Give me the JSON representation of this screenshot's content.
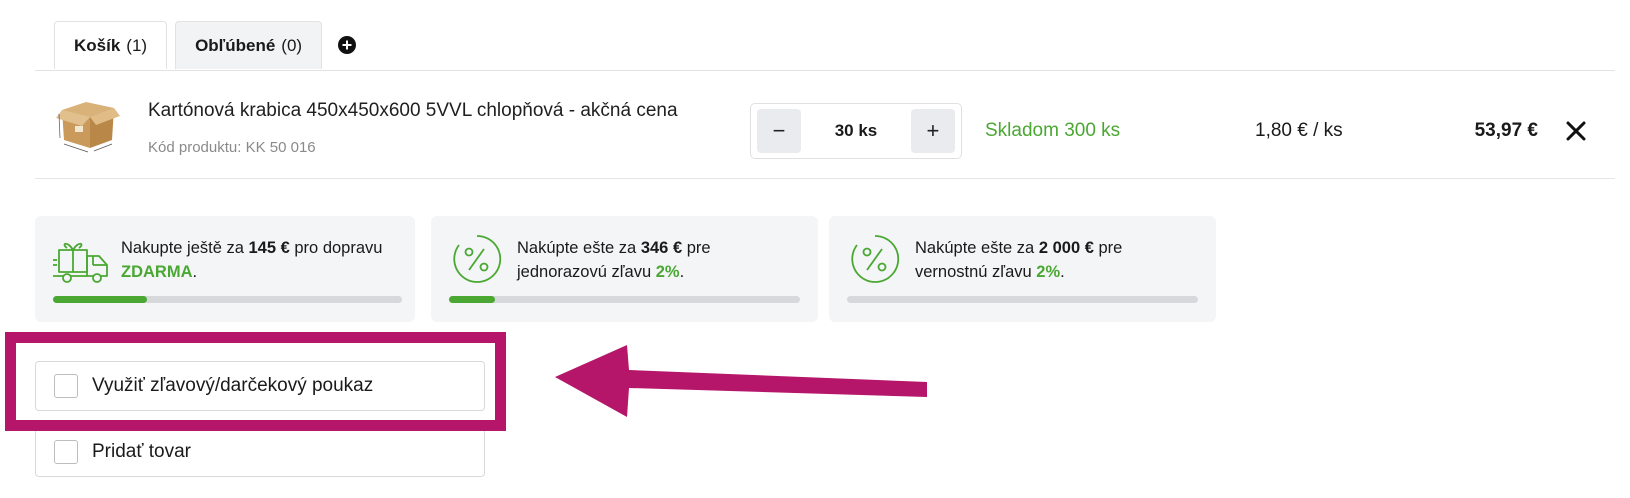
{
  "tabs": [
    {
      "label": "Košík",
      "count": "(1)"
    },
    {
      "label": "Obľúbené",
      "count": "(0)"
    }
  ],
  "icons": {
    "add_tab": "plus-circle-icon",
    "remove": "close-icon",
    "truck": "gift-truck-icon",
    "percent": "percent-circle-icon"
  },
  "colors": {
    "accent_green": "#4aa832",
    "annotation": "#b5166a"
  },
  "product": {
    "name": "Kartónová krabica 450x450x600 5VVL chlopňová - akčná cena",
    "code": "Kód produktu: KK 50 016",
    "quantity": "30 ks",
    "minus": "−",
    "plus": "+",
    "stock": "Skladom 300 ks",
    "unit_price": "1,80 € / ks",
    "total": "53,97 €"
  },
  "promos": [
    {
      "pre": "Nakupte ještě za ",
      "amount": "145 €",
      "mid": " pro dopravu ",
      "highlight": "ZDARMA",
      "post": ".",
      "progress": 0.27
    },
    {
      "pre": "Nakúpte ešte za ",
      "amount": "346 €",
      "mid": " pre jednorazovú zľavu ",
      "highlight": "2%",
      "post": ".",
      "progress": 0.13
    },
    {
      "pre": "Nakúpte ešte za ",
      "amount": "2 000 €",
      "mid": " pre vernostnú zľavu ",
      "highlight": "2%",
      "post": ".",
      "progress": 0.0
    }
  ],
  "options": {
    "voucher": "Využiť zľavový/darčekový poukaz",
    "add_item": "Pridať tovar"
  }
}
